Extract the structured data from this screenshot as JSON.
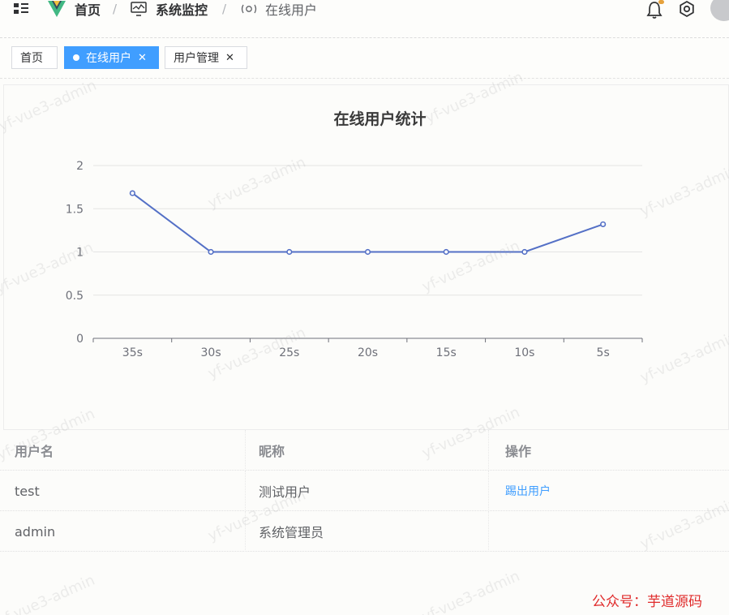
{
  "header": {
    "breadcrumb": {
      "home": "首页",
      "separator": "/",
      "monitor": "系统监控",
      "current": "在线用户"
    }
  },
  "tabs": [
    {
      "label": "首页"
    },
    {
      "label": "在线用户",
      "active": true
    },
    {
      "label": "用户管理"
    }
  ],
  "tab_close_glyph": "✕",
  "chart_data": {
    "type": "line",
    "title": "在线用户统计",
    "categories": [
      "35s",
      "30s",
      "25s",
      "20s",
      "15s",
      "10s",
      "5s"
    ],
    "values": [
      1.68,
      1,
      1,
      1,
      1,
      1,
      1.32
    ],
    "yticks": [
      "0",
      "0.5",
      "1",
      "1.5",
      "2"
    ],
    "ylim": [
      0,
      2
    ],
    "grid": true,
    "line_color": "#5470c6"
  },
  "table": {
    "headers": [
      "用户名",
      "昵称",
      "操作"
    ],
    "rows": [
      {
        "username": "test",
        "nickname": "测试用户",
        "action": "踢出用户"
      },
      {
        "username": "admin",
        "nickname": "系统管理员",
        "action": ""
      }
    ]
  },
  "watermark_text": "yf-vue3-admin",
  "footer_credit": "公众号：芋道源码",
  "colors": {
    "accent": "#409eff",
    "line": "#5470c6",
    "credit": "#e02b2b"
  }
}
